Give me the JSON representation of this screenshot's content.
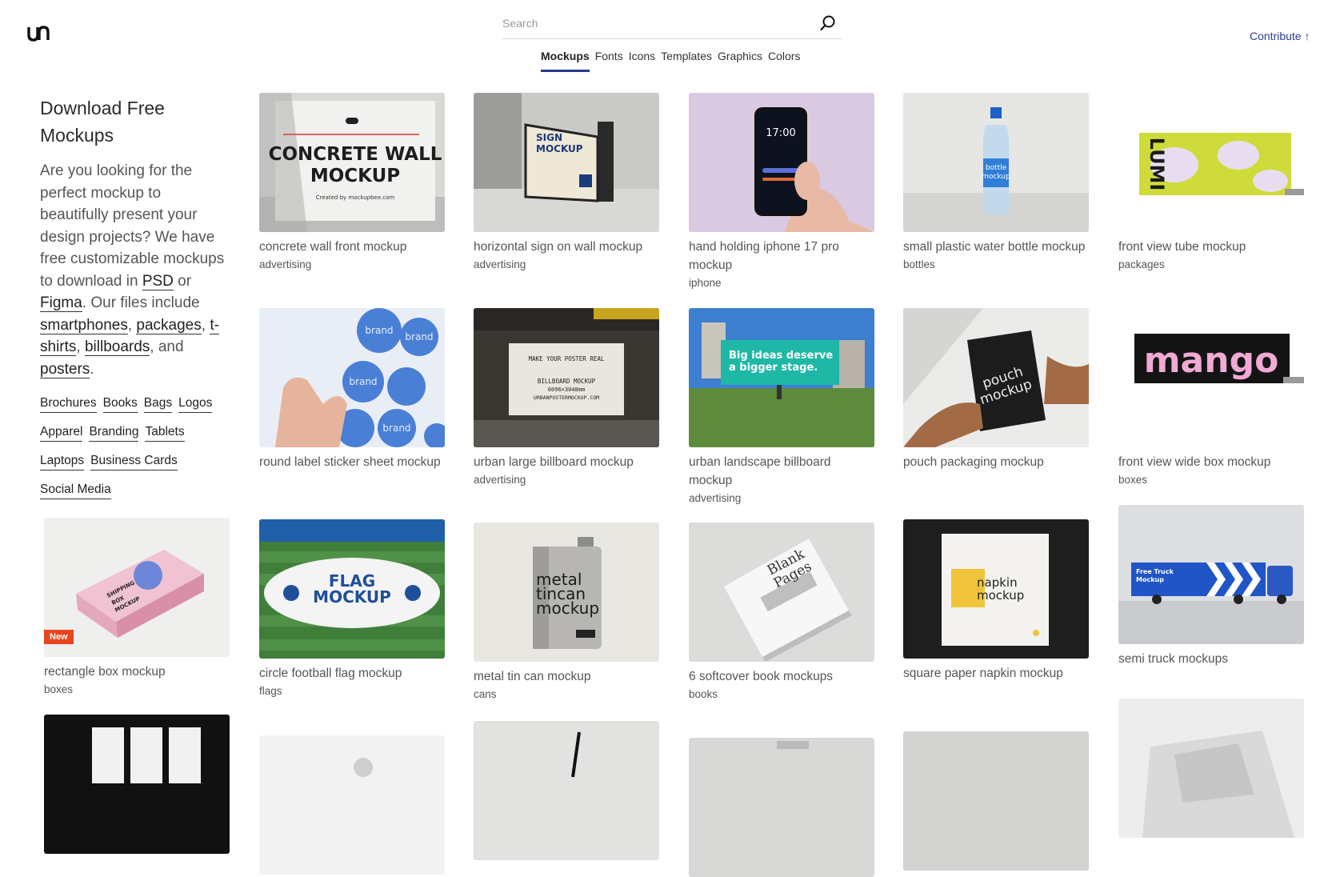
{
  "header": {
    "logo_icon": "unblast-logo",
    "search_placeholder": "Search",
    "search_icon": "search-icon",
    "nav": [
      "Mockups",
      "Fonts",
      "Icons",
      "Templates",
      "Graphics",
      "Colors"
    ],
    "active_nav": "Mockups",
    "contribute_label": "Contribute ↑",
    "accent_color": "#243a8c"
  },
  "sidebar": {
    "title": "Download Free Mockups",
    "intro": {
      "t1": "Are you looking for the perfect mockup to beautifully present your design projects? We have free customizable mockups to download in ",
      "l1": "PSD",
      "t2": " or ",
      "l2": "Figma",
      "t3": ". Our files include ",
      "l3": "smartphones",
      "t4": ", ",
      "l4": "packages",
      "t5": ", ",
      "l5": "t-shirts",
      "t6": ", ",
      "l6": "billboards",
      "t7": ", and ",
      "l7": "posters",
      "t8": "."
    },
    "categories": [
      "Brochures",
      "Books",
      "Bags",
      "Logos",
      "Apparel",
      "Branding",
      "Tablets",
      "Laptops",
      "Business Cards",
      "Social Media"
    ]
  },
  "cards": {
    "c1": {
      "title": "concrete wall front mockup",
      "tag": "advertising",
      "thumb_text": [
        "CONCRETE WALL",
        "MOCKUP",
        "Created by mockupbee.com"
      ]
    },
    "c2": {
      "title": "horizontal sign on wall mockup",
      "tag": "advertising",
      "thumb_text": [
        "SIGN",
        "MOCKUP"
      ]
    },
    "c3": {
      "title": "hand holding iphone 17 pro mockup",
      "tag": "iphone",
      "thumb_text": [
        "17:00"
      ]
    },
    "c4": {
      "title": "small plastic water bottle mockup",
      "tag": "bottles",
      "thumb_text": [
        "bottle",
        "mockup"
      ]
    },
    "c5": {
      "title": "front view tube mockup",
      "tag": "packages",
      "thumb_text": [
        "LUMI"
      ]
    },
    "c6": {
      "title": "round label sticker sheet mockup",
      "tag": "",
      "thumb_text": [
        "brand"
      ]
    },
    "c7": {
      "title": "urban large billboard mockup",
      "tag": "advertising",
      "thumb_text": [
        "MAKE YOUR POSTER REAL",
        "BILLBOARD MOCKUP",
        "6096×3048mm",
        "URBANPOSTERMOCKUP.COM"
      ]
    },
    "c8": {
      "title": "urban landscape billboard mockup",
      "tag": "advertising",
      "thumb_text": [
        "Big ideas deserve",
        "a bigger stage."
      ]
    },
    "c9": {
      "title": "pouch packaging mockup",
      "tag": "",
      "thumb_text": [
        "pouch",
        "mockup"
      ]
    },
    "c10": {
      "title": "front view wide box mockup",
      "tag": "boxes",
      "thumb_text": [
        "mango"
      ]
    },
    "c11": {
      "title": "rectangle box mockup",
      "tag": "boxes",
      "badge": "New",
      "thumb_text": [
        "SHIPPING",
        "BOX",
        "MOCKUP"
      ]
    },
    "c12": {
      "title": "circle football flag mockup",
      "tag": "flags",
      "thumb_text": [
        "FLAG",
        "MOCKUP"
      ]
    },
    "c13": {
      "title": "metal tin can mockup",
      "tag": "cans",
      "thumb_text": [
        "metal",
        "tincan",
        "mockup"
      ]
    },
    "c14": {
      "title": "6 softcover book mockups",
      "tag": "books",
      "thumb_text": [
        "Blank",
        "Pages"
      ]
    },
    "c15": {
      "title": "square paper napkin mockup",
      "tag": "",
      "thumb_text": [
        "napkin",
        "mockup"
      ]
    },
    "c16": {
      "title": "semi truck mockups",
      "tag": "",
      "thumb_text": [
        "Free Truck",
        "Mockup"
      ]
    }
  }
}
